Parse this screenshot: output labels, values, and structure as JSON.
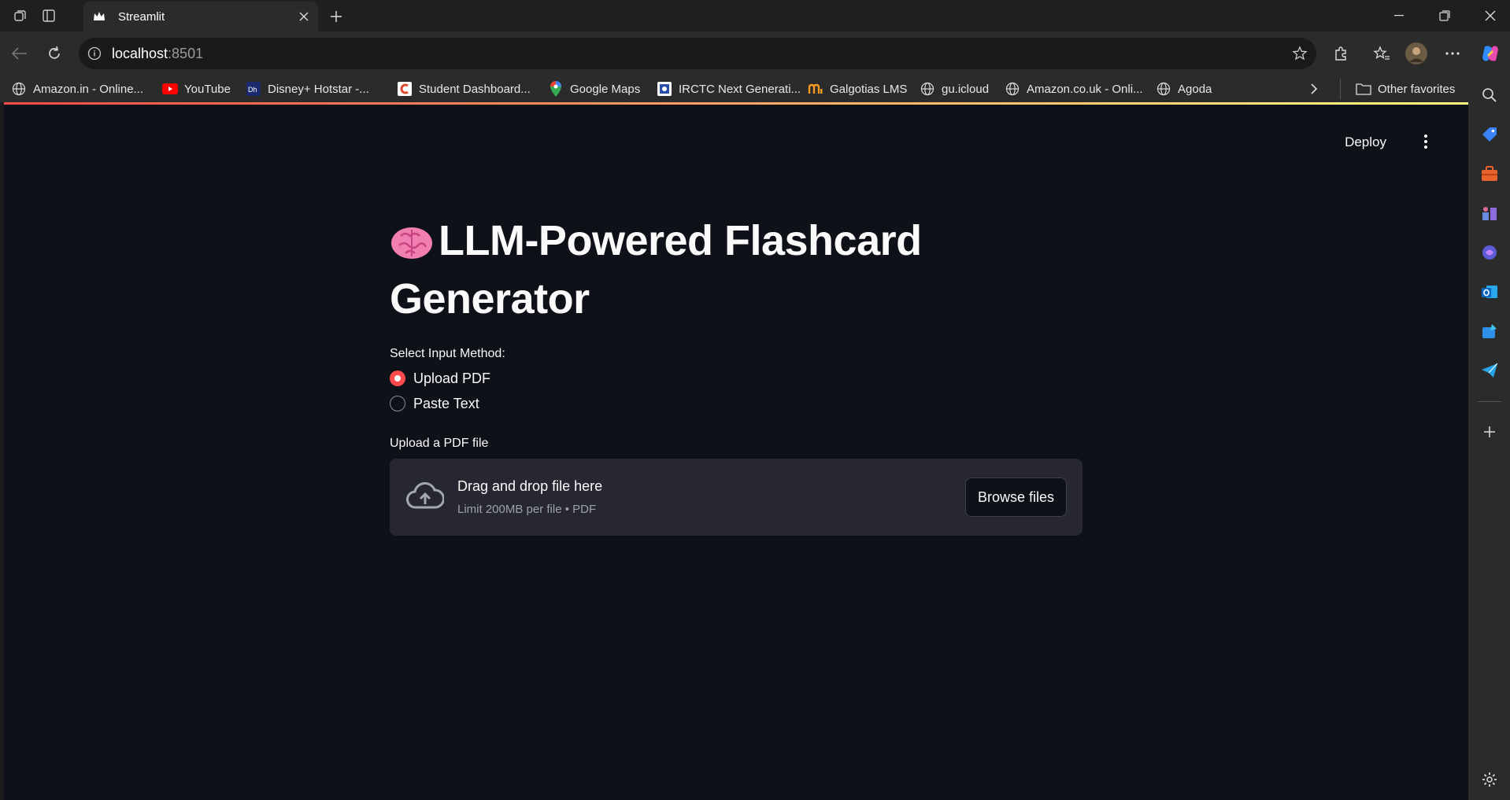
{
  "browser": {
    "tab_title": "Streamlit",
    "url_host": "localhost",
    "url_port": ":8501",
    "bookmarks": [
      {
        "label": "Amazon.in - Online...",
        "icon": "globe-icon"
      },
      {
        "label": "YouTube",
        "icon": "youtube-icon"
      },
      {
        "label": "Disney+ Hotstar -...",
        "icon": "hotstar-icon"
      },
      {
        "label": "Student Dashboard...",
        "icon": "student-dashboard-icon"
      },
      {
        "label": "Google Maps",
        "icon": "map-pin-icon"
      },
      {
        "label": "IRCTC Next Generati...",
        "icon": "irctc-icon"
      },
      {
        "label": "Galgotias LMS",
        "icon": "lms-icon"
      },
      {
        "label": "gu.icloud",
        "icon": "globe-icon"
      },
      {
        "label": "Amazon.co.uk - Onli...",
        "icon": "globe-icon"
      },
      {
        "label": "Agoda",
        "icon": "globe-icon"
      }
    ],
    "other_favorites": "Other favorites"
  },
  "app": {
    "deploy_label": "Deploy",
    "title": "LLM-Powered Flashcard Generator",
    "title_emoji": "brain-emoji",
    "input_method_label": "Select Input Method:",
    "input_options": [
      "Upload PDF",
      "Paste Text"
    ],
    "selected_option": "Upload PDF",
    "uploader_label": "Upload a PDF file",
    "dropzone_title": "Drag and drop file here",
    "dropzone_limit": "Limit 200MB per file • PDF",
    "browse_label": "Browse files"
  },
  "colors": {
    "accent": "#ff4b4b",
    "app_background": "#0e1117",
    "dropzone_background": "#262730",
    "browser_chrome": "#2b2b2b"
  }
}
